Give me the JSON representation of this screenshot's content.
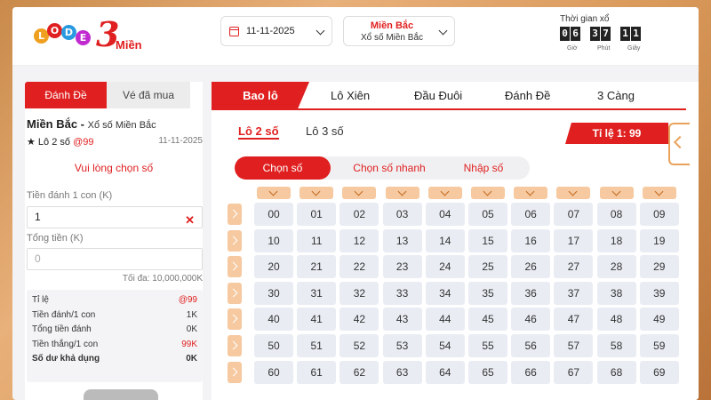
{
  "header": {
    "logo_text": "LODE",
    "logo_number": "3",
    "logo_suffix": "Miền",
    "date": "11-11-2025",
    "region_main": "Miền Bắc",
    "region_sub": "Xổ số Miền Bắc",
    "timer_title": "Thời gian xổ",
    "timer_digits": [
      "0",
      "6",
      "3",
      "7",
      "1",
      "1"
    ],
    "timer_labels": [
      "Giờ",
      "Phút",
      "Giây"
    ]
  },
  "left": {
    "tabs": [
      "Đánh Đề",
      "Vé đã mua"
    ],
    "title_bold": "Miền Bắc -",
    "title_rest": "Xổ số Miền Bắc",
    "bet_type": "★ Lô 2 số",
    "bet_rate": "@99",
    "date": "11-11-2025",
    "warning": "Vui lòng chọn số",
    "amount_label": "Tiền đánh 1 con (K)",
    "amount_value": "1",
    "total_label": "Tổng tiền (K)",
    "total_placeholder": "0",
    "max_note": "Tối đa: 10,000,000K",
    "summary": [
      {
        "label": "Tỉ lệ",
        "value": "@99",
        "red": true,
        "bold": false
      },
      {
        "label": "Tiền đánh/1 con",
        "value": "1K",
        "red": false,
        "bold": false
      },
      {
        "label": "Tổng tiền đánh",
        "value": "0K",
        "red": false,
        "bold": false
      },
      {
        "label": "Tiền thắng/1 con",
        "value": "99K",
        "red": true,
        "bold": false
      },
      {
        "label": "Số dư khả dụng",
        "value": "0K",
        "red": false,
        "bold": true
      }
    ]
  },
  "right": {
    "tabs": [
      "Bao lô",
      "Lô Xiên",
      "Đầu Đuôi",
      "Đánh Đề",
      "3 Càng"
    ],
    "subtabs": [
      "Lô 2 số",
      "Lô 3 số"
    ],
    "ratio": "Tỉ lệ 1: 99",
    "modes": [
      "Chọn số",
      "Chọn số nhanh",
      "Nhập số"
    ],
    "rows": [
      [
        "00",
        "01",
        "02",
        "03",
        "04",
        "05",
        "06",
        "07",
        "08",
        "09"
      ],
      [
        "10",
        "11",
        "12",
        "13",
        "14",
        "15",
        "16",
        "17",
        "18",
        "19"
      ],
      [
        "20",
        "21",
        "22",
        "23",
        "24",
        "25",
        "26",
        "27",
        "28",
        "29"
      ],
      [
        "30",
        "31",
        "32",
        "33",
        "34",
        "35",
        "36",
        "37",
        "38",
        "39"
      ],
      [
        "40",
        "41",
        "42",
        "43",
        "44",
        "45",
        "46",
        "47",
        "48",
        "49"
      ],
      [
        "50",
        "51",
        "52",
        "53",
        "54",
        "55",
        "56",
        "57",
        "58",
        "59"
      ],
      [
        "60",
        "61",
        "62",
        "63",
        "64",
        "65",
        "66",
        "67",
        "68",
        "69"
      ]
    ]
  },
  "colors": {
    "accent": "#e02020",
    "tab_orange": "#f6c9a0",
    "cell_bg": "#e9edf3"
  }
}
